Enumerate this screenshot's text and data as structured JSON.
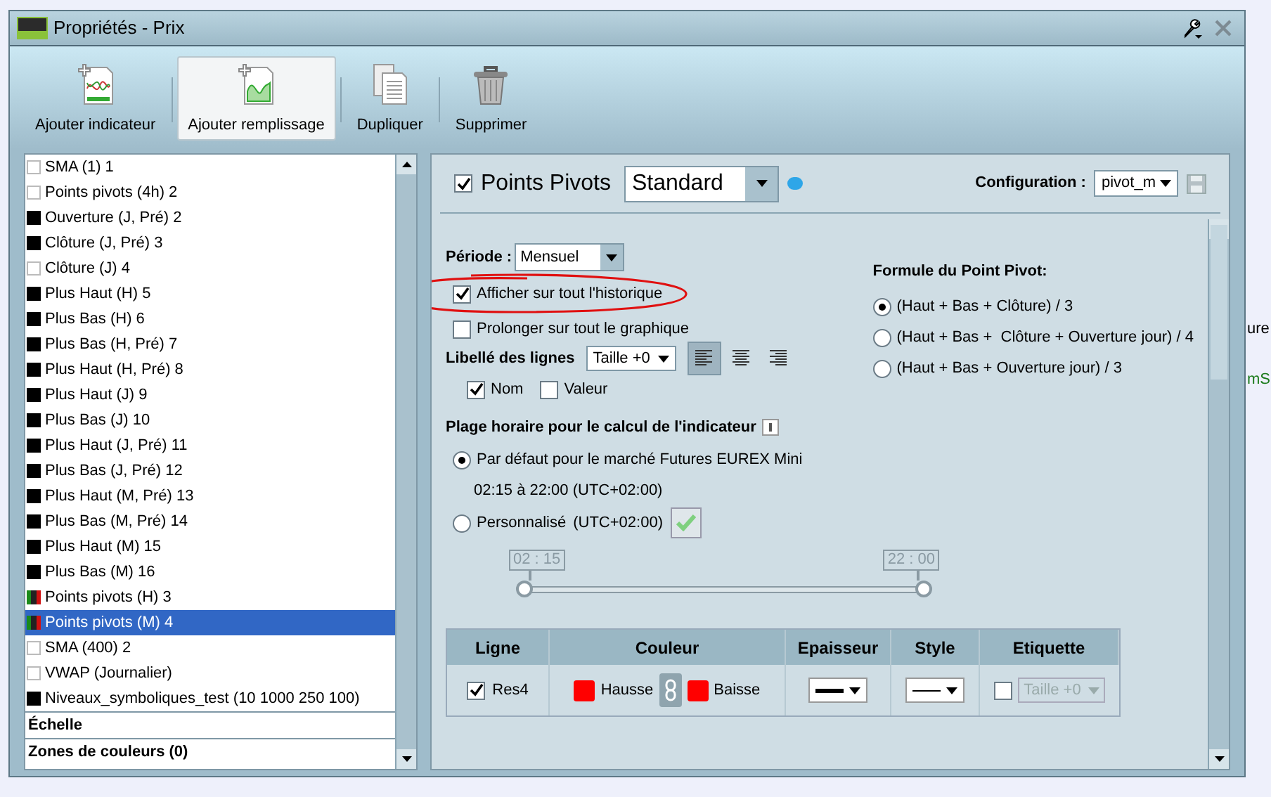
{
  "background": {
    "labels": [
      "ure",
      "mS"
    ]
  },
  "window": {
    "title": "Propriétés - Prix"
  },
  "toolbar": [
    {
      "kind": "indicator",
      "label": "Ajouter indicateur",
      "selected": false
    },
    {
      "kind": "fill",
      "label": "Ajouter remplissage",
      "selected": true
    },
    {
      "kind": "copy",
      "label": "Dupliquer",
      "selected": false
    },
    {
      "kind": "trash",
      "label": "Supprimer",
      "selected": false
    }
  ],
  "list": {
    "items": [
      {
        "label": "SMA (1) 1",
        "kind": "empty",
        "selected": false
      },
      {
        "label": "Points pivots (4h) 2",
        "kind": "empty",
        "selected": false
      },
      {
        "label": "Ouverture (J, Pré) 2",
        "kind": "filled",
        "selected": false
      },
      {
        "label": "Clôture (J, Pré) 3",
        "kind": "filled",
        "selected": false
      },
      {
        "label": "Clôture (J) 4",
        "kind": "empty",
        "selected": false
      },
      {
        "label": "Plus Haut (H) 5",
        "kind": "filled",
        "selected": false
      },
      {
        "label": "Plus Bas (H) 6",
        "kind": "filled",
        "selected": false
      },
      {
        "label": "Plus Bas (H, Pré) 7",
        "kind": "filled",
        "selected": false
      },
      {
        "label": "Plus Haut (H, Pré) 8",
        "kind": "filled",
        "selected": false
      },
      {
        "label": "Plus Haut (J) 9",
        "kind": "filled",
        "selected": false
      },
      {
        "label": "Plus Bas (J) 10",
        "kind": "filled",
        "selected": false
      },
      {
        "label": "Plus Haut (J, Pré) 11",
        "kind": "filled",
        "selected": false
      },
      {
        "label": "Plus Bas (J, Pré) 12",
        "kind": "filled",
        "selected": false
      },
      {
        "label": "Plus Haut (M, Pré) 13",
        "kind": "filled",
        "selected": false
      },
      {
        "label": "Plus Bas (M, Pré) 14",
        "kind": "filled",
        "selected": false
      },
      {
        "label": "Plus Haut (M) 15",
        "kind": "filled",
        "selected": false
      },
      {
        "label": "Plus Bas (M) 16",
        "kind": "filled",
        "selected": false
      },
      {
        "label": "Points pivots (H) 3",
        "kind": "pivot",
        "selected": false
      },
      {
        "label": "Points pivots (M) 4",
        "kind": "pivot",
        "selected": true
      },
      {
        "label": "SMA (400) 2",
        "kind": "empty",
        "selected": false
      },
      {
        "label": "VWAP (Journalier)",
        "kind": "empty",
        "selected": false
      },
      {
        "label": "Niveaux_symboliques_test (10 1000 250 100)",
        "kind": "filled",
        "selected": false
      }
    ],
    "sections": [
      "Échelle",
      "Zones de couleurs (0)"
    ]
  },
  "panel": {
    "indicator": {
      "checked": true,
      "name": "Points Pivots",
      "preset": "Standard"
    },
    "configuration": {
      "label": "Configuration :",
      "value": "pivot_m"
    },
    "period": {
      "label": "Période :",
      "value": "Mensuel"
    },
    "options": [
      {
        "label": "Afficher sur tout l'historique",
        "checked": true
      },
      {
        "label": "Prolonger sur tout le graphique",
        "checked": false
      }
    ],
    "line_labels": {
      "label": "Libellé des lignes",
      "size": "Taille +0",
      "alignments": [
        {
          "kind": "left",
          "selected": true
        },
        {
          "kind": "center",
          "selected": false
        },
        {
          "kind": "right",
          "selected": false
        }
      ],
      "fields": [
        {
          "label": "Nom",
          "checked": true
        },
        {
          "label": "Valeur",
          "checked": false
        }
      ]
    },
    "formula": {
      "title": "Formule du Point Pivot:",
      "options": [
        {
          "label": "(Haut + Bas + Clôture) / 3",
          "selected": true
        },
        {
          "label": "(Haut + Bas +  Clôture + Ouverture jour) / 4",
          "selected": false
        },
        {
          "label": "(Haut + Bas + Ouverture jour) / 3",
          "selected": false
        }
      ]
    },
    "time_range": {
      "title": "Plage horaire pour le calcul de l'indicateur",
      "options": [
        {
          "label": "Par défaut pour le marché Futures EUREX Mini",
          "detail": "02:15 à 22:00 (UTC+02:00)",
          "selected": true
        },
        {
          "label": "Personnalisé",
          "detail": "(UTC+02:00)",
          "selected": false
        }
      ],
      "start": "02 : 15",
      "end": "22 : 00",
      "level": 1
    },
    "table": {
      "columns": [
        "Ligne",
        "Couleur",
        "Epaisseur",
        "Style",
        "Etiquette"
      ],
      "rows": [
        {
          "checked": true,
          "name": "Res4",
          "colors": [
            {
              "label": "Hausse",
              "color": "#ff0000"
            },
            {
              "label": "Baisse",
              "color": "#ff0000"
            }
          ],
          "label_checked": false,
          "label_size": "Taille +0"
        }
      ]
    }
  }
}
